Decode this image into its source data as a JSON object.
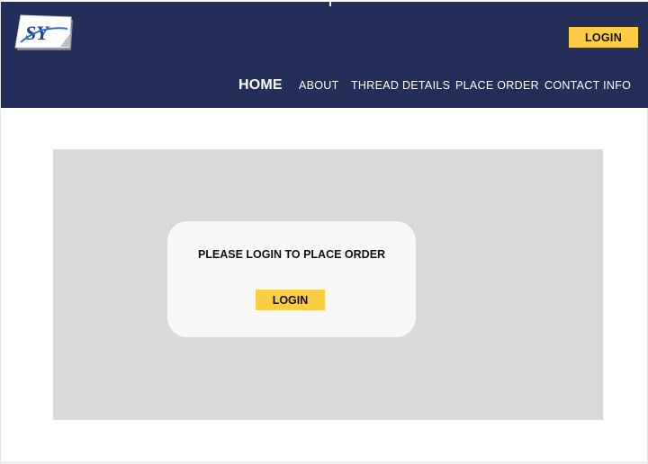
{
  "header": {
    "logo_icon": "sy-logo-icon",
    "login_label": "LOGIN",
    "background_color": "#232f58",
    "accent_color": "#fccd45"
  },
  "nav": {
    "items": [
      {
        "label": "HOME",
        "active": true
      },
      {
        "label": "ABOUT",
        "active": false
      },
      {
        "label": "THREAD DETAILS",
        "active": false
      },
      {
        "label": "PLACE ORDER",
        "active": false
      },
      {
        "label": "CONTACT INFO",
        "active": false
      }
    ]
  },
  "main": {
    "panel_color": "#d9d9d9",
    "card": {
      "message": "PLEASE LOGIN TO PLACE ORDER",
      "login_label": "LOGIN"
    }
  }
}
